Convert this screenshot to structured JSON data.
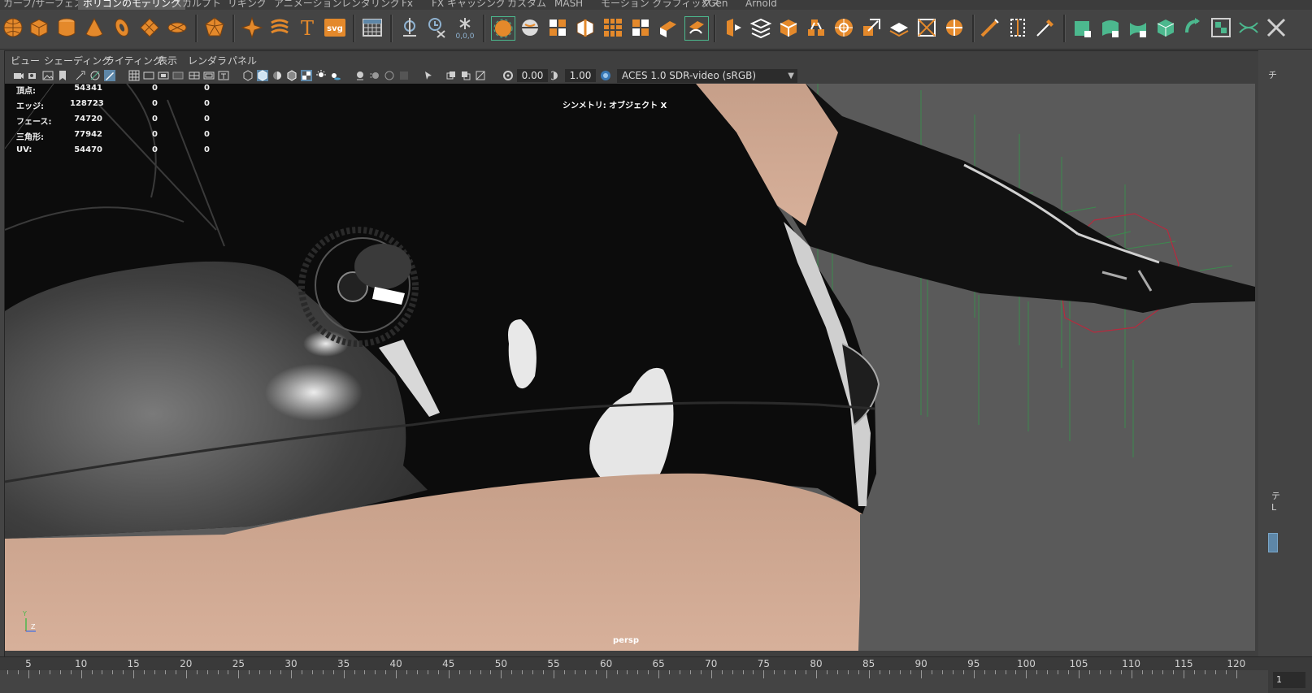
{
  "shelf_tabs": [
    {
      "label": "カーブ/サーフェス",
      "active": false
    },
    {
      "label": "ポリゴンのモデリング",
      "active": true
    },
    {
      "label": "スカルプト",
      "active": false
    },
    {
      "label": "リギング",
      "active": false
    },
    {
      "label": "アニメーション",
      "active": false
    },
    {
      "label": "レンダリング",
      "active": false
    },
    {
      "label": "Fx",
      "active": false
    },
    {
      "label": "FX キャッシング",
      "active": false
    },
    {
      "label": "カスタム",
      "active": false
    },
    {
      "label": "MASH",
      "active": false
    },
    {
      "label": "モーション グラフィックス",
      "active": false
    },
    {
      "label": "XGen",
      "active": false
    },
    {
      "label": "Arnold",
      "active": false
    }
  ],
  "shelf_icons": [
    "poly-sphere-icon",
    "poly-cube-icon",
    "poly-cylinder-icon",
    "poly-cone-icon",
    "poly-torus-icon",
    "poly-plane-icon",
    "poly-disc-icon",
    "platonic-solid-icon",
    "super-shape-icon",
    "sweep-mesh-icon",
    "text-icon",
    "svg-icon",
    "grid-icon",
    "mirror-icon",
    "clear-history-icon",
    "freeze-transform-icon",
    "combine-icon",
    "separate-icon",
    "smooth-icon",
    "reduce-icon",
    "extract-icon",
    "bridge-icon",
    "extrude-icon",
    "bevel-icon",
    "fill-hole-icon",
    "bool-union-icon",
    "bool-difference-icon",
    "bool-intersect-icon",
    "merge-icon",
    "center-pivot-icon",
    "circularize-icon",
    "multi-cut-icon",
    "insert-loop-icon",
    "target-weld-icon",
    "uv-planar-icon",
    "uv-cylindrical-icon",
    "uv-spherical-icon",
    "uv-automatic-icon",
    "uv-editor-icon",
    "uv-checker-icon",
    "uv-unfold-icon",
    "uv-layout-icon"
  ],
  "shelf_text_icons": {
    "text": "T",
    "svg": "svg",
    "mirror_value": "0,0,0"
  },
  "panel_menu": [
    "ビュー",
    "シェーディング",
    "ライティング",
    "表示",
    "レンダラ",
    "パネル"
  ],
  "panel_toolbar": {
    "exposure": "0.00",
    "gamma": "1.00",
    "color_space": "ACES 1.0 SDR-video (sRGB)"
  },
  "hud": {
    "rows": [
      {
        "label": "頂点:",
        "v1": "54341",
        "v2": "0",
        "v3": "0"
      },
      {
        "label": "エッジ:",
        "v1": "128723",
        "v2": "0",
        "v3": "0"
      },
      {
        "label": "フェース:",
        "v1": "74720",
        "v2": "0",
        "v3": "0"
      },
      {
        "label": "三角形:",
        "v1": "77942",
        "v2": "0",
        "v3": "0"
      },
      {
        "label": "UV:",
        "v1": "54470",
        "v2": "0",
        "v3": "0"
      }
    ],
    "symmetry": "シンメトリ: オブジェクト X",
    "camera": "persp",
    "axis_y": "Y",
    "axis_z": "Z"
  },
  "timeline": {
    "ticks": [
      "5",
      "10",
      "15",
      "20",
      "25",
      "30",
      "35",
      "40",
      "45",
      "50",
      "55",
      "60",
      "65",
      "70",
      "75",
      "80",
      "85",
      "90",
      "95",
      "100",
      "105",
      "110",
      "115",
      "120"
    ]
  },
  "right_side": {
    "chars": [
      "チ",
      "テ",
      "L"
    ],
    "frame": "1"
  },
  "colors": {
    "shelf_orange": "#e4892b",
    "shelf_green": "#4cb88e",
    "highlight_blue": "#5e87a8",
    "skin": "#d6ad96"
  }
}
